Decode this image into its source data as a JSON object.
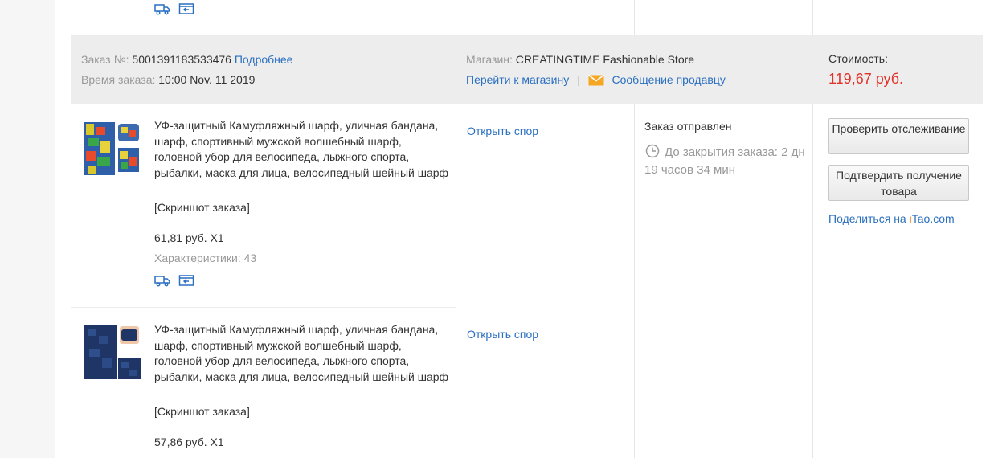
{
  "order": {
    "number_label": "Заказ №:",
    "number": "5001391183533476",
    "details_link": "Подробнее",
    "time_label": "Время заказа:",
    "time": "10:00 Nov. 11 2019",
    "store_label": "Магазин:",
    "store_name": "CREATINGTIME Fashionable Store",
    "go_to_store": "Перейти к магазину",
    "separator": "|",
    "message_seller": "Сообщение продавцу",
    "cost_label": "Стоимость:",
    "cost": "119,67 руб."
  },
  "status": {
    "title": "Заказ отправлен",
    "countdown": "До закрытия заказа: 2 дн 19 часов 34 мин"
  },
  "actions": {
    "track": "Проверить отслеживание",
    "confirm": "Подтвердить получение товара",
    "share_prefix": "Поделиться на ",
    "share_i": "i",
    "share_tao": "Tao",
    "share_com": ".com"
  },
  "items": [
    {
      "title": "УФ-защитный Камуфляжный шарф, уличная бандана, шарф, спортивный мужской волшебный шарф, головной убор для велосипеда, лыжного спорта, рыбалки, маска для лица, велосипедный шейный шарф",
      "snapshot": "[Скриншот заказа]",
      "price": "61,81 руб. X1",
      "specs": "Характеристики: 43",
      "dispute": "Открыть спор"
    },
    {
      "title": "УФ-защитный Камуфляжный шарф, уличная бандана, шарф, спортивный мужской волшебный шарф, головной убор для велосипеда, лыжного спорта, рыбалки, маска для лица, велосипедный шейный шарф",
      "snapshot": "[Скриншот заказа]",
      "price": "57,86 руб. X1",
      "dispute": "Открыть спор"
    }
  ],
  "colors": {
    "link": "#2a6fc0",
    "price": "#e0342a",
    "header_bg": "#ededed"
  }
}
